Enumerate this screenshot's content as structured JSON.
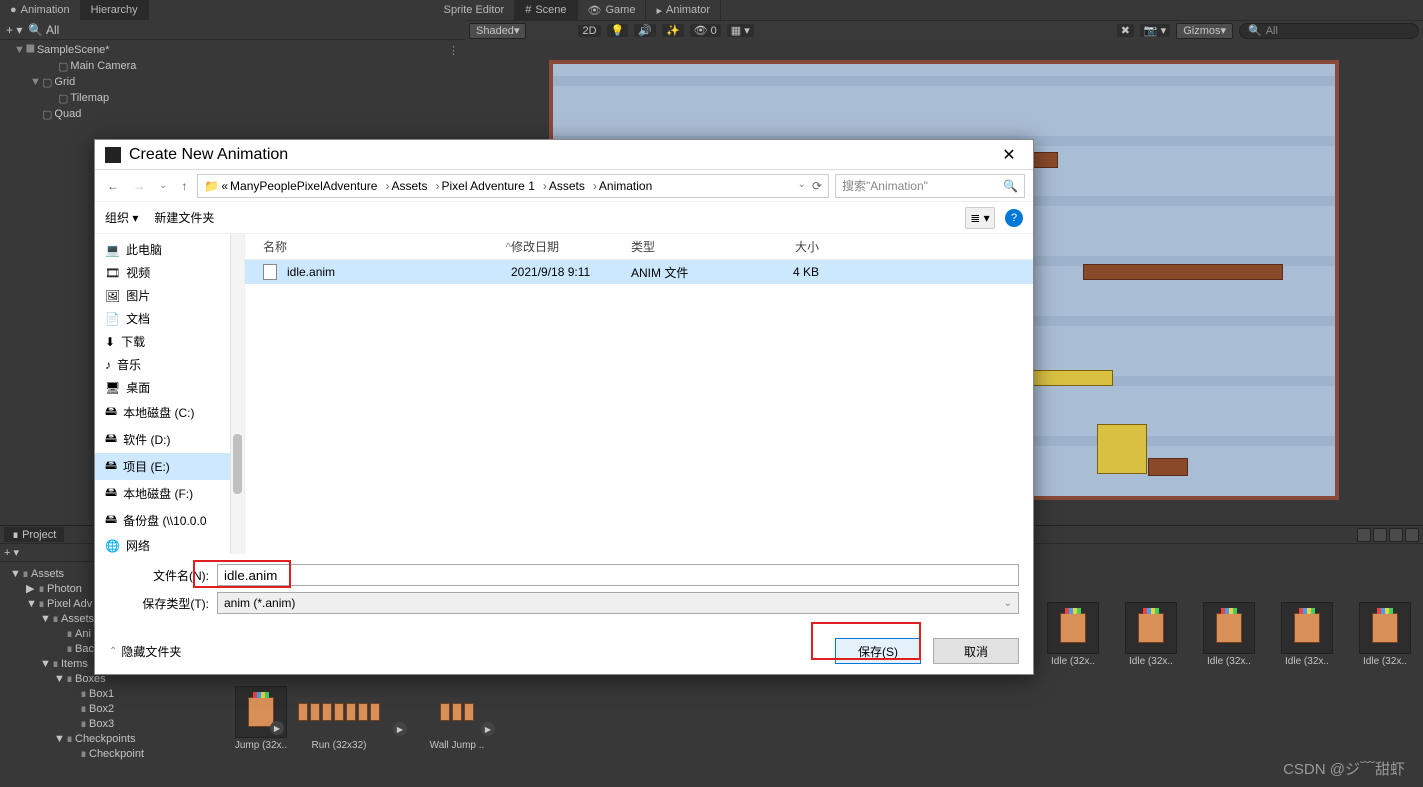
{
  "top_tabs_left": {
    "animation": "Animation",
    "hierarchy": "Hierarchy"
  },
  "top_tabs_right": {
    "sprite_editor": "Sprite Editor",
    "scene": "Scene",
    "game": "Game",
    "animator": "Animator"
  },
  "hierarchy_toolbar": {
    "search_placeholder": "All"
  },
  "scene_toolbar": {
    "shading": "Shaded",
    "mode_2d": "2D",
    "audio_badge": "0",
    "gizmos": "Gizmos",
    "search_placeholder": "All"
  },
  "hierarchy": {
    "scene_name": "SampleScene*",
    "items": [
      {
        "label": "Main Camera",
        "indent": "indent2"
      },
      {
        "label": "Grid",
        "indent": "indent1",
        "arrow": "▼"
      },
      {
        "label": "Tilemap",
        "indent": "indent2"
      },
      {
        "label": "Quad",
        "indent": "indent1"
      }
    ]
  },
  "dialog": {
    "title": "Create New Animation",
    "breadcrumb": [
      "ManyPeoplePixelAdventure",
      "Assets",
      "Pixel Adventure 1",
      "Assets",
      "Animation"
    ],
    "breadcrumb_prefix": "«",
    "search_placeholder": "搜索\"Animation\"",
    "cmd_organize": "组织",
    "cmd_newfolder": "新建文件夹",
    "columns": {
      "name": "名称",
      "date": "修改日期",
      "type": "类型",
      "size": "大小"
    },
    "file_row": {
      "name": "idle.anim",
      "date": "2021/9/18 9:11",
      "type": "ANIM 文件",
      "size": "4 KB"
    },
    "sidebar": [
      {
        "label": "此电脑",
        "icon": "💻"
      },
      {
        "label": "视频",
        "icon": "🎞"
      },
      {
        "label": "图片",
        "icon": "🖼"
      },
      {
        "label": "文档",
        "icon": "📄"
      },
      {
        "label": "下载",
        "icon": "⬇"
      },
      {
        "label": "音乐",
        "icon": "♪"
      },
      {
        "label": "桌面",
        "icon": "🖥"
      },
      {
        "label": "本地磁盘 (C:)",
        "icon": "🖴"
      },
      {
        "label": "软件 (D:)",
        "icon": "🖴"
      },
      {
        "label": "项目 (E:)",
        "icon": "🖴",
        "active": true
      },
      {
        "label": "本地磁盘 (F:)",
        "icon": "🖴"
      },
      {
        "label": "备份盘 (\\\\10.0.0",
        "icon": "🖴"
      },
      {
        "label": "网络",
        "icon": "🌐"
      }
    ],
    "filename_label": "文件名(N):",
    "filename_value": "idle.anim",
    "savetype_label": "保存类型(T):",
    "savetype_value": "anim (*.anim)",
    "hide_folders": "隐藏文件夹",
    "save_btn": "保存(S)",
    "cancel_btn": "取消"
  },
  "project_tab": "Project",
  "project_tree": [
    {
      "label": "Assets",
      "indent": 10,
      "arrow": "▼"
    },
    {
      "label": "Photon",
      "indent": 26,
      "arrow": "▶"
    },
    {
      "label": "Pixel Adv",
      "indent": 26,
      "arrow": "▼"
    },
    {
      "label": "Assets",
      "indent": 40,
      "arrow": "▼"
    },
    {
      "label": "Ani",
      "indent": 54
    },
    {
      "label": "Background",
      "indent": 54
    },
    {
      "label": "Items",
      "indent": 40,
      "arrow": "▼"
    },
    {
      "label": "Boxes",
      "indent": 54,
      "arrow": "▼"
    },
    {
      "label": "Box1",
      "indent": 68
    },
    {
      "label": "Box2",
      "indent": 68
    },
    {
      "label": "Box3",
      "indent": 68
    },
    {
      "label": "Checkpoints",
      "indent": 54,
      "arrow": "▼"
    },
    {
      "label": "Checkpoint",
      "indent": 68
    }
  ],
  "assets_top_row": [
    "Idle (32x..",
    "Idle (32x..",
    "Idle (32x..",
    "Idle (32x..",
    "Idle (32x.."
  ],
  "assets_bottom_row": {
    "jump": "Jump (32x..",
    "run": "Run (32x32)",
    "walljump": "Wall Jump .."
  },
  "watermark": "CSDN @ジ﹋甜虾"
}
